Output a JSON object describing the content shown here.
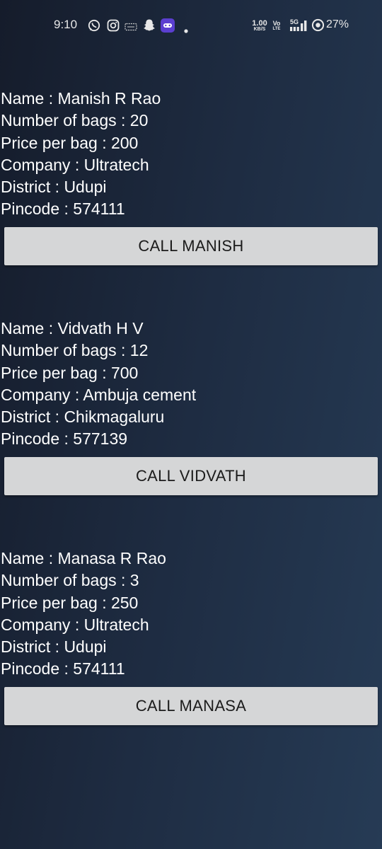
{
  "status_bar": {
    "time": "9:10",
    "speed_value": "1.00",
    "speed_unit": "KB/S",
    "volte_top": "Vo",
    "volte_bottom": "LTE",
    "network": "5G",
    "battery": "27%"
  },
  "listings": [
    {
      "name_line": "Name : Manish R Rao",
      "bags_line": "Number of bags : 20",
      "price_line": "Price per bag : 200",
      "company_line": "Company : Ultratech",
      "district_line": "District : Udupi",
      "pincode_line": "Pincode : 574111",
      "button_label": "CALL MANISH"
    },
    {
      "name_line": "Name : Vidvath H V",
      "bags_line": "Number of bags : 12",
      "price_line": "Price per bag : 700",
      "company_line": "Company : Ambuja cement",
      "district_line": "District : Chikmagaluru",
      "pincode_line": "Pincode : 577139",
      "button_label": "CALL VIDVATH"
    },
    {
      "name_line": "Name : Manasa R Rao",
      "bags_line": "Number of bags : 3",
      "price_line": "Price per bag : 250",
      "company_line": "Company : Ultratech",
      "district_line": "District : Udupi",
      "pincode_line": "Pincode : 574111",
      "button_label": "CALL MANASA"
    }
  ]
}
